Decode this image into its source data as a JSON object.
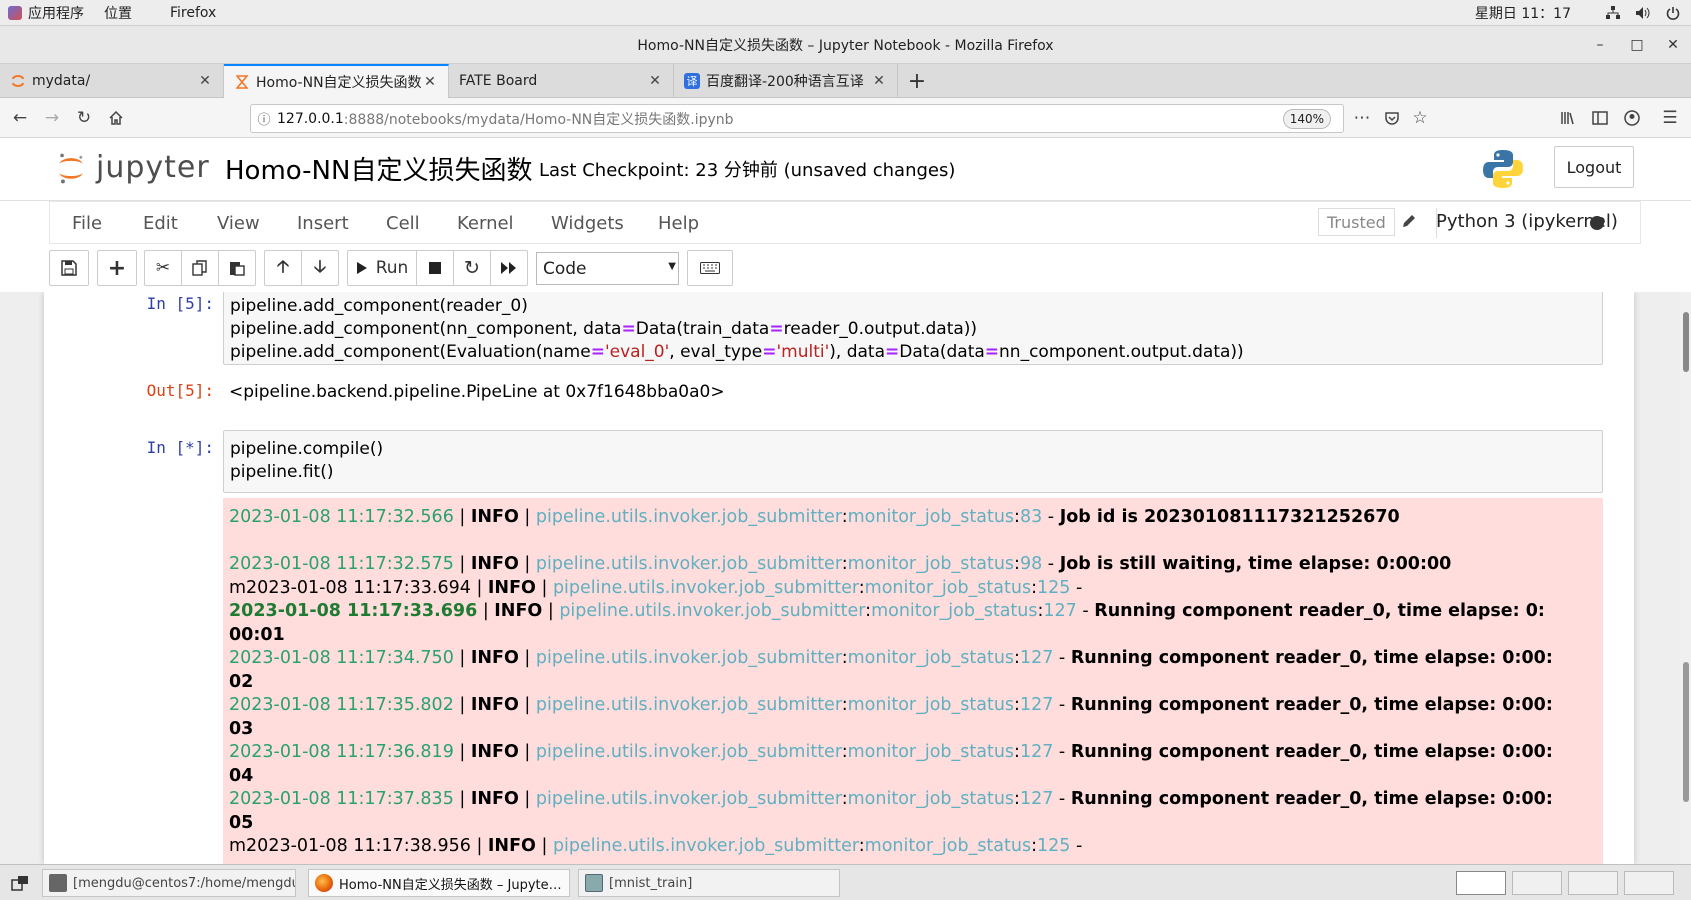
{
  "topbar": {
    "apps": "应用程序",
    "places": "位置",
    "firefox": "Firefox",
    "clock": "星期日 11：17"
  },
  "window": {
    "title": "Homo-NN自定义损失函数  –  Jupyter Notebook - Mozilla Firefox"
  },
  "tabs": [
    {
      "title": "mydata/"
    },
    {
      "title": "Homo-NN自定义损失函数"
    },
    {
      "title": "FATE Board"
    },
    {
      "title": "百度翻译-200种语言互译"
    }
  ],
  "url": {
    "host": "127.0.0.1",
    "path": ":8888/notebooks/mydata/Homo-NN自定义损失函数.ipynb",
    "zoom": "140%"
  },
  "jupyter": {
    "logo_text": "jupyter",
    "notebook_title": "Homo-NN自定义损失函数",
    "checkpoint": "Last Checkpoint: 23 分钟前   (unsaved changes)",
    "logout": "Logout",
    "menu": [
      "File",
      "Edit",
      "View",
      "Insert",
      "Cell",
      "Kernel",
      "Widgets",
      "Help"
    ],
    "trusted": "Trusted",
    "kernel": "Python 3 (ipykernel)",
    "run_label": "Run",
    "cell_type": "Code"
  },
  "cells": {
    "cell5_prompt": "In [5]:",
    "cell5_out_prompt": "Out[5]:",
    "cell5_output": "<pipeline.backend.pipeline.PipeLine at 0x7f1648bba0a0>",
    "cell6_prompt": "In [*]:",
    "cell6_line1": "pipeline.compile()",
    "cell6_line2": "pipeline.fit()"
  },
  "log": {
    "module": "pipeline.utils.invoker.job_submitter",
    "func": "monitor_job_status",
    "lines": [
      {
        "ts": "2023-01-08 11:17:32.566",
        "level": "INFO",
        "line": "83",
        "msg": "Job id is 202301081117321252670"
      },
      {
        "ts": "2023-01-08 11:17:32.575",
        "level": "INFO",
        "line": "98",
        "msg": "Job is still waiting, time elapse: 0:00:00"
      },
      {
        "ts": "m2023-01-08 11:17:33.694",
        "level": "INFO",
        "line": "125",
        "msg": ""
      },
      {
        "ts": "2023-01-08 11:17:33.696",
        "level": "INFO",
        "line": "127",
        "msg": "Running component reader_0, time elapse: 0:",
        "cont": "00:01"
      },
      {
        "ts": "2023-01-08 11:17:34.750",
        "level": "INFO",
        "line": "127",
        "msg": "Running component reader_0, time elapse: 0:00:",
        "cont": "02"
      },
      {
        "ts": "2023-01-08 11:17:35.802",
        "level": "INFO",
        "line": "127",
        "msg": "Running component reader_0, time elapse: 0:00:",
        "cont": "03"
      },
      {
        "ts": "2023-01-08 11:17:36.819",
        "level": "INFO",
        "line": "127",
        "msg": "Running component reader_0, time elapse: 0:00:",
        "cont": "04"
      },
      {
        "ts": "2023-01-08 11:17:37.835",
        "level": "INFO",
        "line": "127",
        "msg": "Running component reader_0, time elapse: 0:00:",
        "cont": "05"
      },
      {
        "ts": "m2023-01-08 11:17:38.956",
        "level": "INFO",
        "line": "125",
        "msg": ""
      }
    ]
  },
  "taskbar": [
    {
      "label": "[mengdu@centos7:/home/mengdu/…"
    },
    {
      "label": "Homo-NN自定义损失函数 – Jupyte…"
    },
    {
      "label": "[mnist_train]"
    }
  ]
}
